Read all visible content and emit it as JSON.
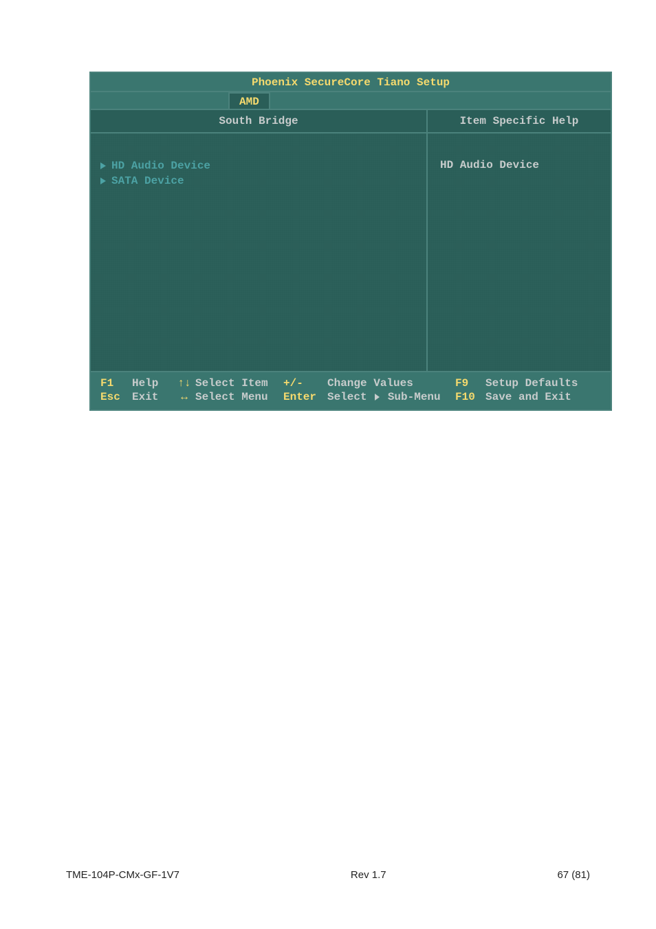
{
  "bios": {
    "title": "Phoenix SecureCore Tiano Setup",
    "active_tab": "AMD",
    "subheader_left": "South Bridge",
    "subheader_right": "Item Specific Help",
    "menu_items": [
      {
        "label": "HD Audio Device"
      },
      {
        "label": "SATA Device"
      }
    ],
    "help_text": "HD Audio Device",
    "footer_rows": [
      {
        "k": "F1",
        "a1": "Help",
        "ik": "↑↓",
        "a2": "Select Item",
        "k2": "+/-",
        "a3": "Change Values",
        "k3": "F9",
        "a4": "Setup Defaults"
      },
      {
        "k": "Esc",
        "a1": "Exit",
        "ik": "↔",
        "a2": "Select Menu",
        "k2": "Enter",
        "a3_pre": "Select ",
        "a3_post": " Sub-Menu",
        "k3": "F10",
        "a4": "Save and Exit"
      }
    ]
  },
  "page_footer": {
    "left": "TME-104P-CMx-GF-1V7",
    "center": "Rev 1.7",
    "right": "67 (81)"
  }
}
